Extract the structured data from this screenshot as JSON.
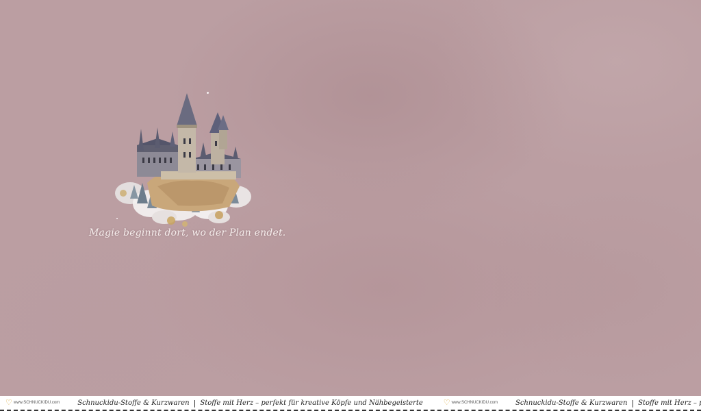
{
  "quote": "Magie beginnt dort, wo der Plan endet.",
  "footer": {
    "logo_text": "www.SCHNUCKIDU.com",
    "shop_name": "Schnuckidu-Stoffe & Kurzwaren",
    "separator": "|",
    "slogan": "Stoffe mit Herz – perfekt für kreative Köpfe und Nähbegeisterte"
  },
  "colors": {
    "background": "#bb9ea2",
    "quote_text": "#f7efee",
    "logo_heart": "#d9a93a",
    "footer_bg": "#ffffff"
  },
  "icons": {
    "logo": "heart-icon",
    "illustration": "castle-illustration"
  }
}
